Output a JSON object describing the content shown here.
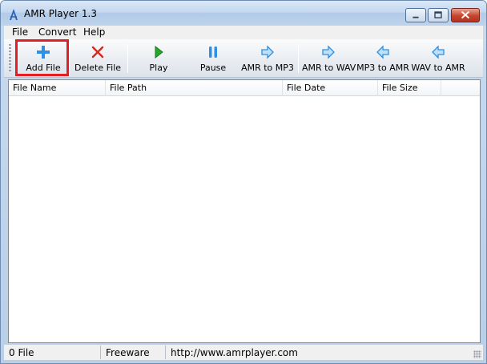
{
  "window": {
    "title": "AMR Player 1.3",
    "app_icon": "amr-player-icon"
  },
  "menu": {
    "items": [
      {
        "label": "File"
      },
      {
        "label": "Convert"
      },
      {
        "label": "Help"
      }
    ]
  },
  "toolbar": {
    "buttons": [
      {
        "label": "Add File",
        "icon": "plus-icon"
      },
      {
        "label": "Delete File",
        "icon": "delete-x-icon"
      },
      {
        "label": "Play",
        "icon": "play-icon"
      },
      {
        "label": "Pause",
        "icon": "pause-icon"
      },
      {
        "label": "AMR to MP3",
        "icon": "arrow-right-icon"
      },
      {
        "label": "AMR to WAV",
        "icon": "arrow-right-icon"
      },
      {
        "label": "MP3 to AMR",
        "icon": "arrow-left-icon"
      },
      {
        "label": "WAV to AMR",
        "icon": "arrow-left-icon"
      }
    ],
    "highlighted_button": "Add File",
    "highlight_color": "#e31e24"
  },
  "file_list": {
    "columns": [
      "File Name",
      "File Path",
      "File Date",
      "File Size"
    ],
    "rows": []
  },
  "status": {
    "file_count": "0 File",
    "license": "Freeware",
    "website": "http://www.amrplayer.com"
  },
  "colors": {
    "accent_blue": "#2f8fe0",
    "delete_red": "#d42a1e",
    "play_green": "#26a62a"
  }
}
